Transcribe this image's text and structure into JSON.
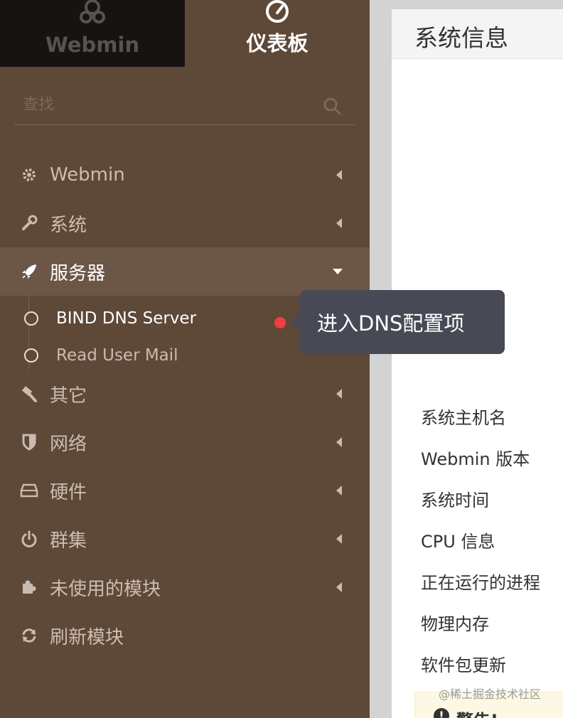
{
  "colors": {
    "sidebar_bg": "#5e4838",
    "sidebar_active": "#6c5646",
    "tab_dark": "#171312",
    "tooltip_bg": "#474a55",
    "dot": "#ef3f3f"
  },
  "tabs": {
    "webmin_label": "Webmin",
    "dashboard_label": "仪表板"
  },
  "search": {
    "placeholder": "查找"
  },
  "nav": {
    "webmin": "Webmin",
    "system": "系统",
    "servers": "服务器",
    "others": "其它",
    "network": "网络",
    "hardware": "硬件",
    "cluster": "群集",
    "unused_modules": "未使用的模块",
    "refresh_modules": "刷新模块"
  },
  "servers_sub": {
    "bind": "BIND DNS Server",
    "read_mail": "Read User Mail"
  },
  "tooltip": {
    "text": "进入DNS配置项"
  },
  "panel": {
    "title": "系统信息",
    "rows": [
      "系统主机名",
      "Webmin 版本",
      "系统时间",
      "CPU 信息",
      "正在运行的进程",
      "物理内存",
      "软件包更新"
    ],
    "warning": "警告!"
  },
  "watermark": "@稀土掘金技术社区"
}
